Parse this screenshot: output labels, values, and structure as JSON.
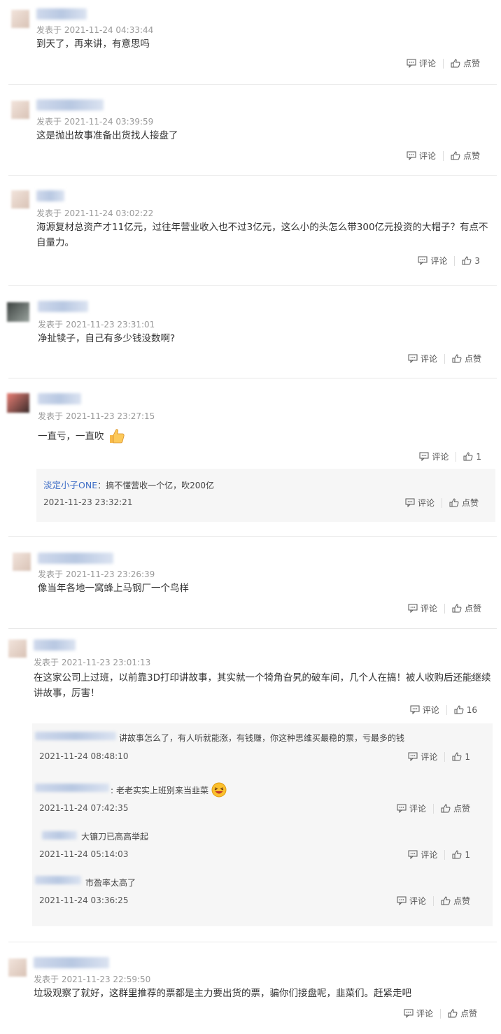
{
  "posted_prefix": "发表于",
  "comment_label": "评论",
  "like_label": "点赞",
  "comments": [
    {
      "time": "2021-11-24 04:33:44",
      "text": "到天了，再来讲，有意思吗",
      "likes": "点赞"
    },
    {
      "time": "2021-11-24 03:39:59",
      "text": "这是抛出故事准备出货找人接盘了",
      "likes": "点赞"
    },
    {
      "time": "2021-11-24 03:02:22",
      "text": "海源复材总资产才11亿元，过往年营业收入也不过3亿元，这么小的头怎么带300亿元投资的大帽子？有点不自量力。",
      "likes": "3"
    },
    {
      "time": "2021-11-23 23:31:01",
      "text": "净扯犊子，自己有多少钱没数啊?",
      "likes": "点赞"
    },
    {
      "time": "2021-11-23 23:27:15",
      "text": "一直亏，一直吹",
      "likes": "1",
      "replies": [
        {
          "name": "淡定小子ONE",
          "text": "搞不懂营收一个亿，吹200亿",
          "time": "2021-11-23 23:32:21",
          "likes": "点赞"
        }
      ]
    },
    {
      "time": "2021-11-23 23:26:39",
      "text": "像当年各地一窝蜂上马钢厂一个鸟样",
      "likes": "点赞"
    },
    {
      "time": "2021-11-23 23:01:13",
      "text": "在这家公司上过班，以前靠3D打印讲故事，其实就一个犄角旮旯的破车间，几个人在搞！被人收购后还能继续讲故事，厉害！",
      "likes": "16",
      "replies": [
        {
          "text": "讲故事怎么了，有人听就能涨，有钱赚，你这种思维买最稳的票，亏最多的钱",
          "time": "2021-11-24 08:48:10",
          "likes": "1"
        },
        {
          "text": "老老实实上班别来当韭菜",
          "time": "2021-11-24 07:42:35",
          "likes": "点赞"
        },
        {
          "text": "大镰刀已高高举起",
          "time": "2021-11-24 05:14:03",
          "likes": "1"
        },
        {
          "text": "市盈率太高了",
          "time": "2021-11-24 03:36:25",
          "likes": "点赞"
        }
      ]
    },
    {
      "time": "2021-11-23 22:59:50",
      "text": "垃圾观察了就好，这群里推荐的票都是主力要出货的票，骗你们接盘呢，韭菜们。赶紧走吧",
      "likes": "点赞"
    }
  ]
}
